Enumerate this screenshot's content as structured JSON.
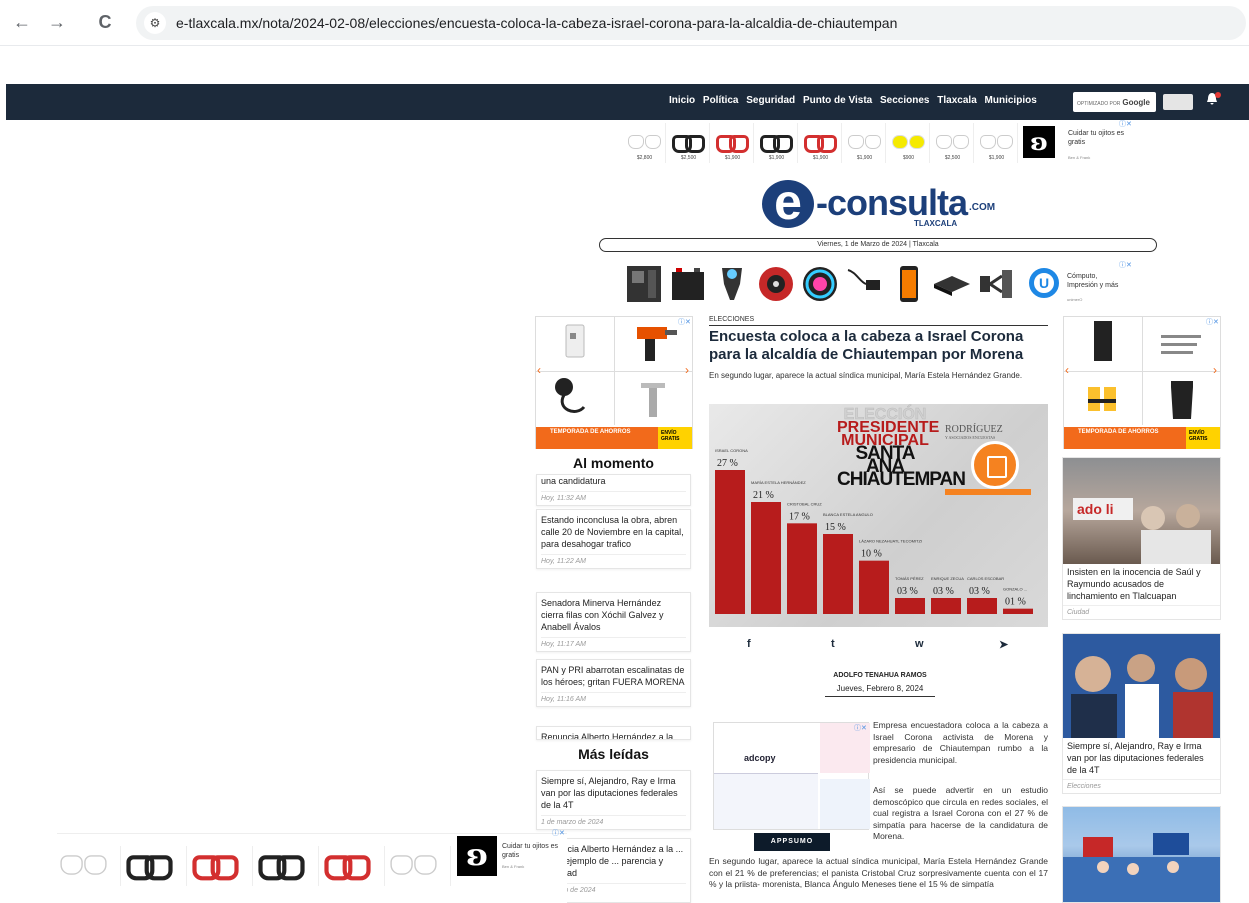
{
  "browser": {
    "url": "e-tlaxcala.mx/nota/2024-02-08/elecciones/encuesta-coloca-la-cabeza-israel-corona-para-la-alcaldia-de-chiautempan",
    "back_icon": "←",
    "forward_icon": "→",
    "reload_icon": "C",
    "tune_icon": "⚙"
  },
  "nav": {
    "items": [
      "Inicio",
      "Política",
      "Seguridad",
      "Punto de Vista",
      "Secciones",
      "Tlaxcala",
      "Municipios"
    ],
    "search_badge": "OPTIMIZADO POR",
    "search_brand": "Google"
  },
  "top_ad": {
    "prices": [
      "$2,800",
      "$2,500",
      "$1,900",
      "$1,900",
      "$1,900",
      "$1,900",
      "$900",
      "$2,500",
      "$1,900"
    ],
    "text": "Cuidar tu ojitos es gratis",
    "sub": "Ben & Frank",
    "logo": "ʚ",
    "adchoice": "ⓘ✕"
  },
  "masthead": {
    "logo_e": "e",
    "logo_word": "-consulta",
    "logo_com": ".COM",
    "logo_region": "TLAXCALA",
    "date": "Viernes, 1 de Marzo de 2024 | Tlaxcala"
  },
  "products_ad": {
    "text": "Cómputo, Impresión y más",
    "sub": "unimerO",
    "adchoice": "ⓘ✕"
  },
  "left_ad": {
    "bottom_text": "TEMPORADA DE AHORROS",
    "badge": "ENVÍO GRATIS",
    "adchoice": "ⓘ✕"
  },
  "right_ad": {
    "bottom_text": "TEMPORADA DE AHORROS",
    "badge": "ENVÍO GRATIS",
    "adchoice": "ⓘ✕"
  },
  "al_momento": {
    "title": "Al momento",
    "items": [
      {
        "title": "una candidatura",
        "time": "Hoy, 11:32 AM"
      },
      {
        "title": "Estando inconclusa la obra, abren calle 20 de Noviembre en la capital, para desahogar trafico",
        "time": "Hoy, 11:22 AM"
      },
      {
        "title": "Senadora Minerva Hernández cierra filas con Xóchil Galvez y Anabell Ávalos",
        "time": "Hoy, 11:17 AM"
      },
      {
        "title": "PAN y PRI abarrotan escalinatas de los héroes; gritan FUERA MORENA",
        "time": "Hoy, 11:16 AM"
      },
      {
        "title": "Renuncia Alberto Hernández a la",
        "time": ""
      }
    ]
  },
  "mas_leidas": {
    "title": "Más leídas",
    "items": [
      {
        "title": "Siempre sí, Alejandro, Ray e Irma van por las diputaciones federales de la 4T",
        "time": "1 de marzo de 2024"
      },
      {
        "title": "Renuncia Alberto Hernández a la ... lanza ejemplo de ... parencia y legalidad",
        "time": "... marzo de 2024"
      }
    ]
  },
  "article": {
    "category": "ELECCIONES",
    "headline": "Encuesta coloca a la cabeza a Israel Corona para la alcaldía de Chiautempan por Morena",
    "lead": "En segundo lugar, aparece la actual síndica municipal, María Estela Hernández Grande.",
    "author": "ADOLFO TENAHUA RAMOS",
    "date": "Jueves, Febrero 8, 2024",
    "share_icons": [
      "f",
      "t",
      "w",
      "➤"
    ],
    "para1": "Empresa encuestadora coloca a la cabeza a Israel Corona activista de Morena y empresario de Chiautempan rumbo a la presidencia municipal.",
    "para2": "Así se puede advertir en un estudio demoscópico que circula en redes sociales, el cual registra a Israel Corona con el 27 % de simpatía para hacerse de la candidatura de Morena.",
    "para3": "En segundo lugar, aparece la actual síndica municipal, María Estela Hernández Grande con el 21 % de preferencias; el panista Cristobal Cruz sorpresivamente cuenta con el 17 % y la priista- morenista, Blanca Ángulo Meneses tiene el 15 % de simpatía"
  },
  "chart_image": {
    "title_lines": [
      "ELECCIÓN",
      "PRESIDENTE MUNICIPAL",
      "SANTA ANA CHIAUTEMPAN"
    ],
    "pollster": "RODRÍGUEZ",
    "pollster_sub": "Y ASOCIADOS ENCUESTAS",
    "bar_color": "#b71c1c"
  },
  "chart_data": {
    "type": "bar",
    "categories": [
      "ISRAEL CORONA",
      "MARÍA ESTELA HERNÁNDEZ",
      "CRISTOBAL CRUZ",
      "BLANCA ESTELA ANGULO",
      "LÁZARO NEZAHUATL TECOMITZI",
      "TOMÁS PÉREZ",
      "ENRIQUE ZECUA",
      "CARLOS ESCOBAR",
      "GONZALO ... "
    ],
    "values": [
      27,
      21,
      17,
      15,
      10,
      3,
      3,
      3,
      1
    ],
    "labels": [
      "27 %",
      "21 %",
      "17 %",
      "15 %",
      "10 %",
      "03 %",
      "03 %",
      "03 %",
      "01 %"
    ],
    "title": "ELECCIÓN PRESIDENTE MUNICIPAL SANTA ANA CHIAUTEMPAN",
    "ylim": [
      0,
      30
    ]
  },
  "adcopy": {
    "brand": "adcopy",
    "cta": "APPSUMO",
    "adchoice": "ⓘ✕"
  },
  "right_news": [
    {
      "title": "Insisten en la inocencia de Saúl y Raymundo acusados de linchamiento en Tlalcuapan",
      "section": "Ciudad"
    },
    {
      "title": "Siempre sí, Alejandro, Ray e Irma van por las diputaciones federales de la 4T",
      "section": "Elecciones"
    },
    {
      "title": "",
      "section": ""
    }
  ],
  "bottom_ad": {
    "text": "Cuidar tu ojitos es gratis",
    "sub": "Ben & Frank",
    "logo": "ʚ",
    "adchoice": "ⓘ✕"
  }
}
